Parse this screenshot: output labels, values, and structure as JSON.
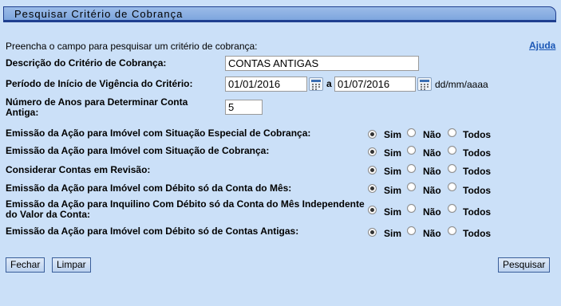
{
  "title": "Pesquisar Critério de Cobrança",
  "intro": "Preencha o campo para pesquisar um critério de cobrança:",
  "help_link": "Ajuda",
  "fields": {
    "descricao_label": "Descrição do Critério de Cobrança:",
    "descricao_value": "CONTAS ANTIGAS",
    "periodo_label": "Período de Início de Vigência do Critério:",
    "periodo_inicio": "01/01/2016",
    "periodo_sep": "a",
    "periodo_fim": "01/07/2016",
    "periodo_format": "dd/mm/aaaa",
    "anos_label": "Número de Anos para Determinar Conta Antiga:",
    "anos_value": "5"
  },
  "radio_options": [
    "Sim",
    "Não",
    "Todos"
  ],
  "radio_groups": [
    {
      "label": "Emissão da Ação para Imóvel com Situação Especial de Cobrança:",
      "selected": "Sim"
    },
    {
      "label": "Emissão da Ação para Imóvel com Situação de Cobrança:",
      "selected": "Sim"
    },
    {
      "label": "Considerar Contas em Revisão:",
      "selected": "Sim"
    },
    {
      "label": "Emissão da Ação para Imóvel com Débito só da Conta do Mês:",
      "selected": "Sim"
    },
    {
      "label": "Emissão da Ação para Inquilino Com Débito só da Conta do Mês Independente do Valor da Conta:",
      "selected": "Sim"
    },
    {
      "label": "Emissão da Ação para Imóvel com Débito só de Contas Antigas:",
      "selected": "Sim"
    }
  ],
  "buttons": {
    "fechar": "Fechar",
    "limpar": "Limpar",
    "pesquisar": "Pesquisar"
  },
  "icons": {
    "calendar": "calendar-icon"
  }
}
